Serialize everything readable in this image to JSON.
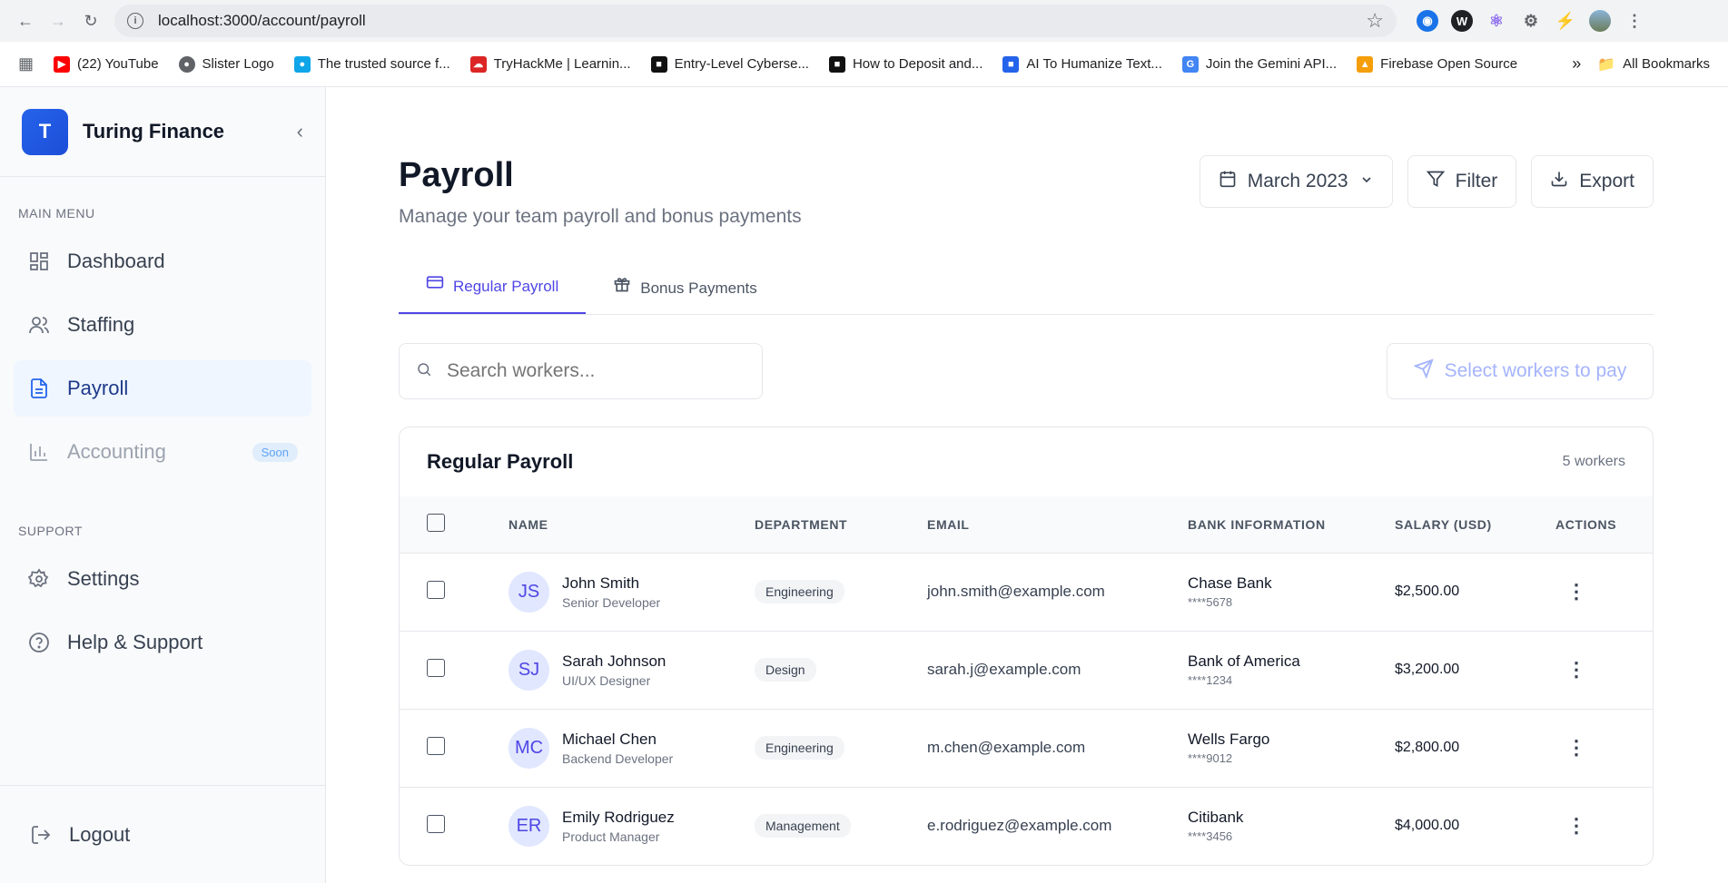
{
  "browser": {
    "url": "localhost:3000/account/payroll",
    "bookmarks": [
      {
        "label": "(22) YouTube",
        "icon": "youtube-icon",
        "color": "#ff0000"
      },
      {
        "label": "Slister Logo",
        "icon": "globe-icon",
        "color": "#5f6368"
      },
      {
        "label": "The trusted source f...",
        "icon": "pin-icon",
        "color": "#0ea5e9"
      },
      {
        "label": "TryHackMe | Learnin...",
        "icon": "cloud-icon",
        "color": "#dc2626"
      },
      {
        "label": "Entry-Level Cyberse...",
        "icon": "site-icon",
        "color": "#111111"
      },
      {
        "label": "How to Deposit and...",
        "icon": "site-icon",
        "color": "#111111"
      },
      {
        "label": "AI To Humanize Text...",
        "icon": "site-icon",
        "color": "#2563eb"
      },
      {
        "label": "Join the Gemini API...",
        "icon": "google-icon",
        "color": "#4285f4"
      },
      {
        "label": "Firebase Open Source",
        "icon": "firebase-icon",
        "color": "#f59e0b"
      }
    ],
    "all_bookmarks": "All Bookmarks"
  },
  "sidebar": {
    "brand_initial": "T",
    "brand_name": "Turing Finance",
    "main_menu_label": "MAIN MENU",
    "items": [
      {
        "label": "Dashboard",
        "icon": "dashboard-icon"
      },
      {
        "label": "Staffing",
        "icon": "users-icon"
      },
      {
        "label": "Payroll",
        "icon": "document-icon"
      },
      {
        "label": "Accounting",
        "icon": "bar-chart-icon",
        "badge": "Soon"
      }
    ],
    "support_label": "SUPPORT",
    "support_items": [
      {
        "label": "Settings",
        "icon": "gear-icon"
      },
      {
        "label": "Help & Support",
        "icon": "help-icon"
      }
    ],
    "logout_label": "Logout"
  },
  "page": {
    "title": "Payroll",
    "subtitle": "Manage your team payroll and bonus payments",
    "month": "March 2023",
    "filter_label": "Filter",
    "export_label": "Export",
    "tabs": [
      {
        "label": "Regular Payroll"
      },
      {
        "label": "Bonus Payments"
      }
    ],
    "search_placeholder": "Search workers...",
    "pay_button": "Select workers to pay"
  },
  "table": {
    "title": "Regular Payroll",
    "count": "5 workers",
    "columns": [
      "NAME",
      "DEPARTMENT",
      "EMAIL",
      "BANK INFORMATION",
      "SALARY (USD)",
      "ACTIONS"
    ],
    "rows": [
      {
        "initials": "JS",
        "name": "John Smith",
        "role": "Senior Developer",
        "dept": "Engineering",
        "email": "john.smith@example.com",
        "bank": "Chase Bank",
        "acct": "****5678",
        "salary": "$2,500.00"
      },
      {
        "initials": "SJ",
        "name": "Sarah Johnson",
        "role": "UI/UX Designer",
        "dept": "Design",
        "email": "sarah.j@example.com",
        "bank": "Bank of America",
        "acct": "****1234",
        "salary": "$3,200.00"
      },
      {
        "initials": "MC",
        "name": "Michael Chen",
        "role": "Backend Developer",
        "dept": "Engineering",
        "email": "m.chen@example.com",
        "bank": "Wells Fargo",
        "acct": "****9012",
        "salary": "$2,800.00"
      },
      {
        "initials": "ER",
        "name": "Emily Rodriguez",
        "role": "Product Manager",
        "dept": "Management",
        "email": "e.rodriguez@example.com",
        "bank": "Citibank",
        "acct": "****3456",
        "salary": "$4,000.00"
      }
    ]
  }
}
